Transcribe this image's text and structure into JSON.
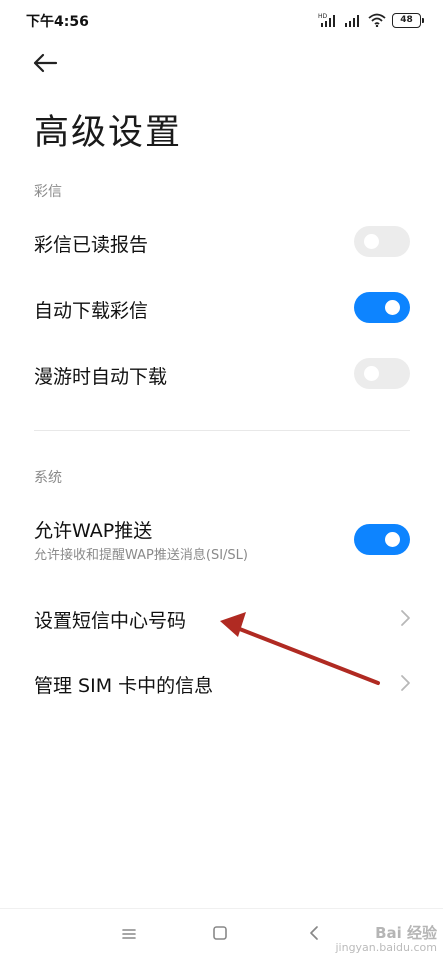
{
  "status_bar": {
    "time": "下午4:56",
    "battery": "48",
    "network_label": "HD"
  },
  "page": {
    "title": "高级设置"
  },
  "sections": {
    "mms": {
      "header": "彩信",
      "items": [
        {
          "label": "彩信已读报告",
          "toggle": false
        },
        {
          "label": "自动下载彩信",
          "toggle": true
        },
        {
          "label": "漫游时自动下载",
          "toggle": false
        }
      ]
    },
    "system": {
      "header": "系统",
      "wap": {
        "label": "允许WAP推送",
        "sublabel": "允许接收和提醒WAP推送消息(SI/SL)",
        "toggle": true
      },
      "sms_center": {
        "label": "设置短信中心号码"
      },
      "sim_messages": {
        "label": "管理 SIM 卡中的信息"
      }
    }
  },
  "colors": {
    "accent": "#0d84ff",
    "toggle_off": "#ececec",
    "annotation_arrow": "#b02a22"
  },
  "icons": {
    "back": "arrow-left-icon",
    "chevron": "chevron-right-icon",
    "nav_menu": "menu-icon",
    "nav_home": "home-square-icon",
    "nav_back": "chevron-left-icon"
  },
  "watermark": {
    "main": "Bai 经验",
    "sub": "jingyan.baidu.com"
  }
}
